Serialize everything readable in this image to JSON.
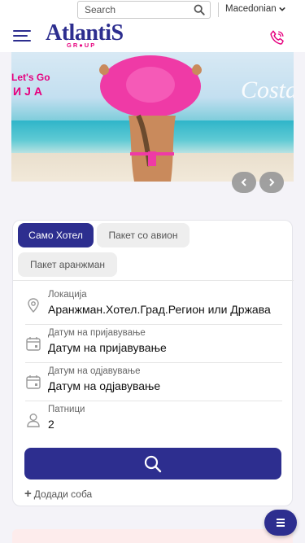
{
  "topbar": {
    "search_placeholder": "Search",
    "language": "Macedonian"
  },
  "header": {
    "logo_main": "AtlantiS",
    "logo_sub": "GR●UP"
  },
  "hero": {
    "promo_line1": "Let's Go",
    "promo_line2": "ИЈА",
    "promo_script": "Costa"
  },
  "booking": {
    "tabs": [
      {
        "label": "Само Хотел",
        "active": true
      },
      {
        "label": "Пакет со авион",
        "active": false
      },
      {
        "label": "Пакет аранжман",
        "active": false
      }
    ],
    "fields": [
      {
        "label": "Локација",
        "value": "Аранжман.Хотел.Град.Регион или Држава",
        "icon": "location-pin-icon"
      },
      {
        "label": "Датум на пријавување",
        "value": "Датум на пријавување",
        "icon": "calendar-icon"
      },
      {
        "label": "Датум на одјавување",
        "value": "Датум на одјавување",
        "icon": "calendar-icon"
      },
      {
        "label": "Патници",
        "value": "2",
        "icon": "user-icon"
      }
    ],
    "add_room": "Додади соба"
  },
  "colors": {
    "brand": "#2d2e8f",
    "accent": "#e6007e"
  }
}
